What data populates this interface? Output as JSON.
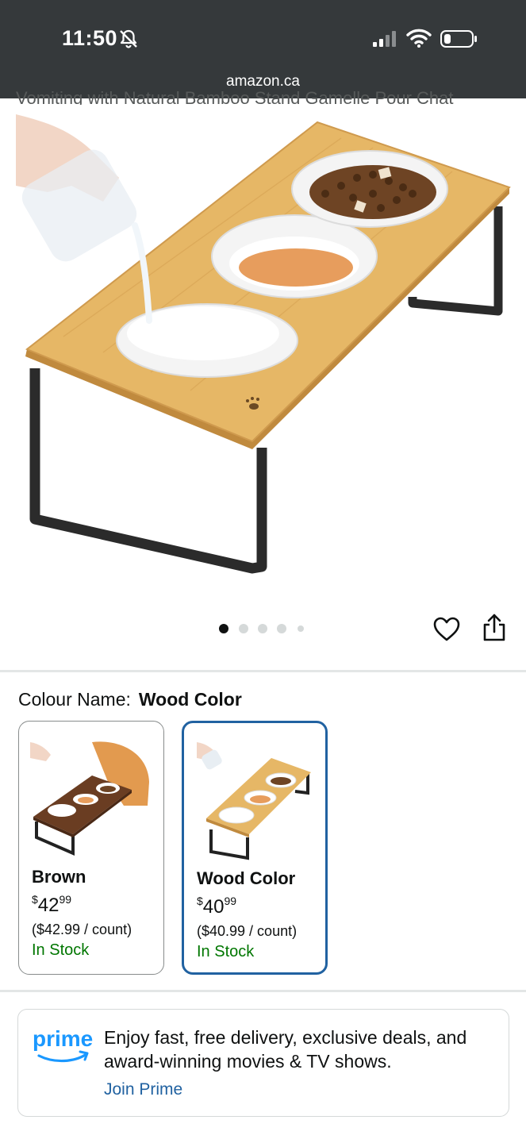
{
  "status_bar": {
    "time": "11:50",
    "url": "amazon.ca"
  },
  "product": {
    "title_cutoff": "Vomiting with Natural Bamboo Stand Gamelle Pour Chat",
    "image_dots": 5,
    "active_dot": 0
  },
  "colour": {
    "label": "Colour Name:",
    "selected": "Wood Color"
  },
  "variants": [
    {
      "name": "Brown",
      "price_symbol": "$",
      "price_whole": "42",
      "price_cents": "99",
      "unit_price": "($42.99 / count)",
      "stock": "In Stock"
    },
    {
      "name": "Wood Color",
      "price_symbol": "$",
      "price_whole": "40",
      "price_cents": "99",
      "unit_price": "($40.99 / count)",
      "stock": "In Stock"
    }
  ],
  "prime": {
    "logo_text": "prime",
    "message": "Enjoy fast, free delivery, exclusive deals, and award-winning movies & TV shows.",
    "link": "Join Prime"
  },
  "colors": {
    "status_bg": "#35393b",
    "link": "#2162a1",
    "in_stock": "#007600",
    "selected_border": "#2162a1",
    "prime_blue": "#1a98ff"
  },
  "icons": [
    "bell-slash-icon",
    "signal-icon",
    "wifi-icon",
    "battery-icon",
    "heart-icon",
    "share-icon"
  ]
}
